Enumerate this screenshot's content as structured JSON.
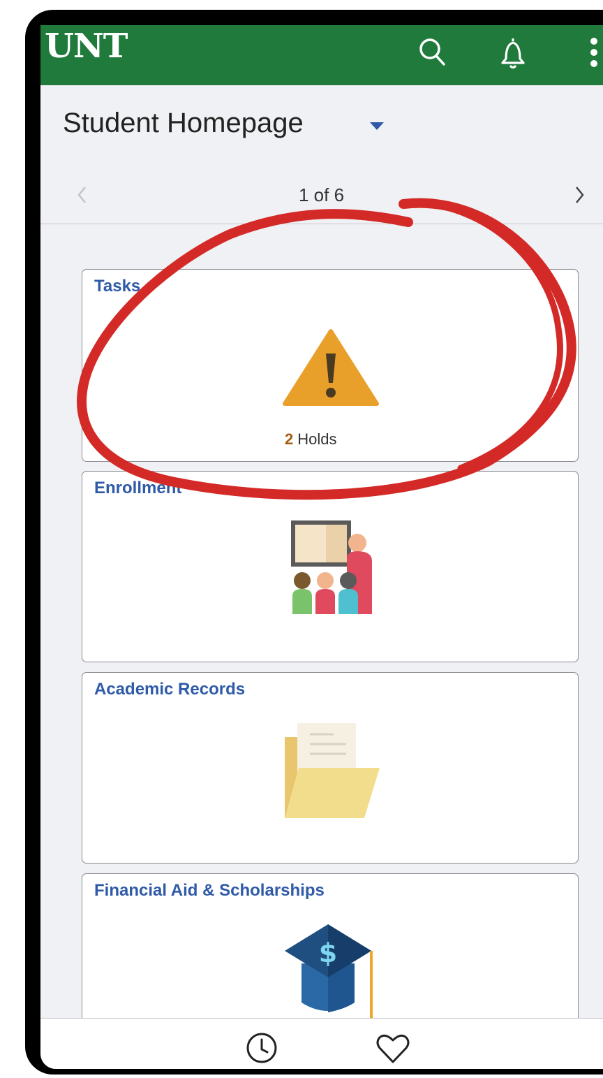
{
  "header": {
    "logo": "UNT",
    "bg_color": "#1f7a3c",
    "icons": [
      "search-icon",
      "bell-icon",
      "more-vertical-icon"
    ]
  },
  "page": {
    "title": "Student Homepage"
  },
  "pager": {
    "text": "1 of 6",
    "prev_icon": "chevron-left-icon",
    "next_icon": "chevron-right-icon"
  },
  "tiles": [
    {
      "title": "Tasks",
      "icon": "warning-icon",
      "count": "2",
      "count_label": "Holds"
    },
    {
      "title": "Enrollment",
      "icon": "classroom-icon"
    },
    {
      "title": "Academic Records",
      "icon": "folder-icon"
    },
    {
      "title": "Financial Aid & Scholarships",
      "icon": "graduation-cap-dollar-icon"
    }
  ],
  "bottom_nav": {
    "icons": [
      "clock-icon",
      "heart-icon"
    ]
  },
  "colors": {
    "accent": "#1f7a3c",
    "link": "#2e5aa8",
    "annotation": "#d42a27",
    "warning": "#e9a02a"
  }
}
